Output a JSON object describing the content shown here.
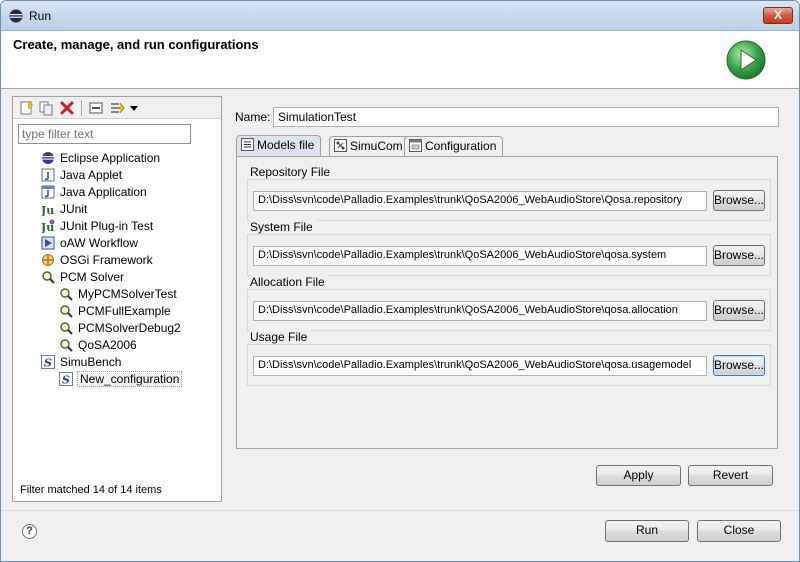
{
  "window": {
    "title": "Run",
    "close_label": "X"
  },
  "banner": {
    "title": "Create, manage, and run configurations",
    "icon": "run-icon"
  },
  "left": {
    "filter_placeholder": "type filter text",
    "tree": [
      {
        "label": "Eclipse Application",
        "icon": "eclipse-icon",
        "level": 0
      },
      {
        "label": "Java Applet",
        "icon": "java-applet-icon",
        "level": 0
      },
      {
        "label": "Java Application",
        "icon": "java-app-icon",
        "level": 0
      },
      {
        "label": "JUnit",
        "icon": "junit-icon",
        "level": 0
      },
      {
        "label": "JUnit Plug-in Test",
        "icon": "junit-plugin-icon",
        "level": 0
      },
      {
        "label": "oAW Workflow",
        "icon": "workflow-icon",
        "level": 0
      },
      {
        "label": "OSGi Framework",
        "icon": "osgi-icon",
        "level": 0
      },
      {
        "label": "PCM Solver",
        "icon": "pcm-solver-icon",
        "level": 0
      },
      {
        "label": "MyPCMSolverTest",
        "icon": "pcm-solver-icon",
        "level": 1
      },
      {
        "label": "PCMFullExample",
        "icon": "pcm-solver-icon",
        "level": 1
      },
      {
        "label": "PCMSolverDebug2",
        "icon": "pcm-solver-icon",
        "level": 1
      },
      {
        "label": "QoSA2006",
        "icon": "pcm-solver-icon",
        "level": 1
      },
      {
        "label": "SimuBench",
        "icon": "simubench-icon",
        "level": 0
      },
      {
        "label": "New_configuration",
        "icon": "simubench-icon",
        "level": 1
      }
    ],
    "status": "Filter matched 14 of 14 items"
  },
  "config": {
    "name_label": "Name:",
    "name_value": "SimulationTest",
    "tabs": [
      {
        "label": "Models file",
        "icon": "models-file-icon"
      },
      {
        "label": "SimuCom",
        "icon": "simucom-icon"
      },
      {
        "label": "Configuration",
        "icon": "configuration-icon"
      }
    ],
    "groups": [
      {
        "label": "Repository File",
        "value": "D:\\Diss\\svn\\code\\Palladio.Examples\\trunk\\QoSA2006_WebAudioStore\\Qosa.repository",
        "browse": "Browse..."
      },
      {
        "label": "System File",
        "value": "D:\\Diss\\svn\\code\\Palladio.Examples\\trunk\\QoSA2006_WebAudioStore\\qosa.system",
        "browse": "Browse..."
      },
      {
        "label": "Allocation File",
        "value": "D:\\Diss\\svn\\code\\Palladio.Examples\\trunk\\QoSA2006_WebAudioStore\\qosa.allocation",
        "browse": "Browse..."
      },
      {
        "label": "Usage File",
        "value": "D:\\Diss\\svn\\code\\Palladio.Examples\\trunk\\QoSA2006_WebAudioStore\\qosa.usagemodel",
        "browse": "Browse..."
      }
    ],
    "apply": "Apply",
    "revert": "Revert"
  },
  "footer": {
    "help": "?",
    "run": "Run",
    "close": "Close"
  },
  "colors": {
    "run_green": "#3aa64a",
    "selection_bg": "#f2f2f2"
  }
}
